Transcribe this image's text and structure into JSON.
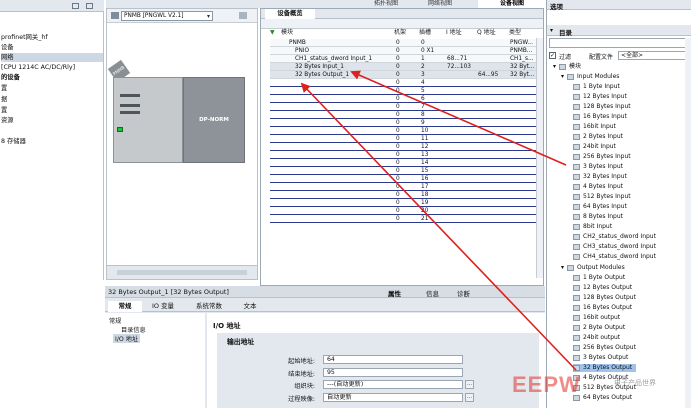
{
  "toolbar": {
    "topology_view": "拓扑视图",
    "network_view": "网络视图",
    "device_view": "设备视图",
    "device_select": "PNMB [PNGWL V2.1]"
  },
  "left_tree": {
    "items": [
      "profinet网关_hf",
      "设备",
      "网络",
      "[CPU 1214C AC/DC/Rly]",
      "的设备",
      "置",
      "据",
      "置",
      "资源",
      "",
      "8 存储器"
    ]
  },
  "canvas": {
    "module_tag": "PNMB",
    "device_label": "DP-NORM"
  },
  "device_overview": {
    "tab": "设备概览",
    "columns": [
      "模块",
      "机架",
      "插槽",
      "I 地址",
      "Q 地址",
      "类型"
    ],
    "rows": [
      {
        "module": "PNMB",
        "rack": "0",
        "slot": "0",
        "i": "",
        "q": "",
        "type": "PNGW..."
      },
      {
        "module": "PNIO",
        "rack": "0",
        "slot": "0 X1",
        "i": "",
        "q": "",
        "type": "PNMB..."
      },
      {
        "module": "CH1_status_dword Input_1",
        "rack": "0",
        "slot": "1",
        "i": "68...71",
        "q": "",
        "type": "CH1_s..."
      },
      {
        "module": "32 Bytes Input_1",
        "rack": "0",
        "slot": "2",
        "i": "72...103",
        "q": "",
        "type": "32 Byt..."
      },
      {
        "module": "32 Bytes Output_1",
        "rack": "0",
        "slot": "3",
        "i": "",
        "q": "64...95",
        "type": "32 Byt..."
      }
    ],
    "empty_slots": [
      "4",
      "5",
      "6",
      "7",
      "8",
      "9",
      "10",
      "11",
      "12",
      "13",
      "14",
      "15",
      "16",
      "17",
      "18",
      "19",
      "20",
      "21"
    ]
  },
  "properties": {
    "title": "32 Bytes Output_1 [32 Bytes Output]",
    "top_tabs": [
      "属性",
      "信息",
      "诊断"
    ],
    "sub_tabs": [
      "常规",
      "IO 变量",
      "系统常数",
      "文本"
    ],
    "nav": [
      "常规",
      "目录信息",
      "I/O 地址"
    ],
    "section": "I/O 地址",
    "subsection": "输出地址",
    "fields": [
      {
        "label": "起始地址:",
        "value": "64"
      },
      {
        "label": "结束地址:",
        "value": "95"
      },
      {
        "label": "组织块:",
        "value": "---(自动更新)"
      },
      {
        "label": "过程映像:",
        "value": "自动更新"
      }
    ]
  },
  "catalog": {
    "header": "选项",
    "section": "目录",
    "filter_label": "过滤",
    "profile_label": "配置文件",
    "profile_value": "<全部>",
    "root": "模块",
    "input_group": "Input Modules",
    "inputs": [
      "1 Byte Input",
      "12 Bytes Input",
      "128 Bytes Input",
      "16 Bytes Input",
      "16bit Input",
      "2 Bytes Input",
      "24bit Input",
      "256 Bytes Input",
      "3 Bytes Input",
      "32 Bytes Input",
      "4 Bytes Input",
      "512 Bytes Input",
      "64 Bytes Input",
      "8 Bytes Input",
      "8bit Input",
      "CH2_status_dword Input",
      "CH3_status_dword Input",
      "CH4_status_dword Input"
    ],
    "output_group": "Output Modules",
    "outputs": [
      "1 Byte Output",
      "12 Bytes Output",
      "128 Bytes Output",
      "16 Bytes Output",
      "16bit output",
      "2 Byte Output",
      "24bit output",
      "256 Bytes Output",
      "3 Bytes Output",
      "32 Bytes Output",
      "4 Bytes Output",
      "512 Bytes Output",
      "64 Bytes Output"
    ],
    "selected": "32 Bytes Output"
  },
  "watermark": {
    "text": "EEPW",
    "sub": "电子产品世界"
  },
  "colors": {
    "accent": "#2b3a8c",
    "arrow": "#e0201c",
    "selection": "#9fc3ec"
  }
}
